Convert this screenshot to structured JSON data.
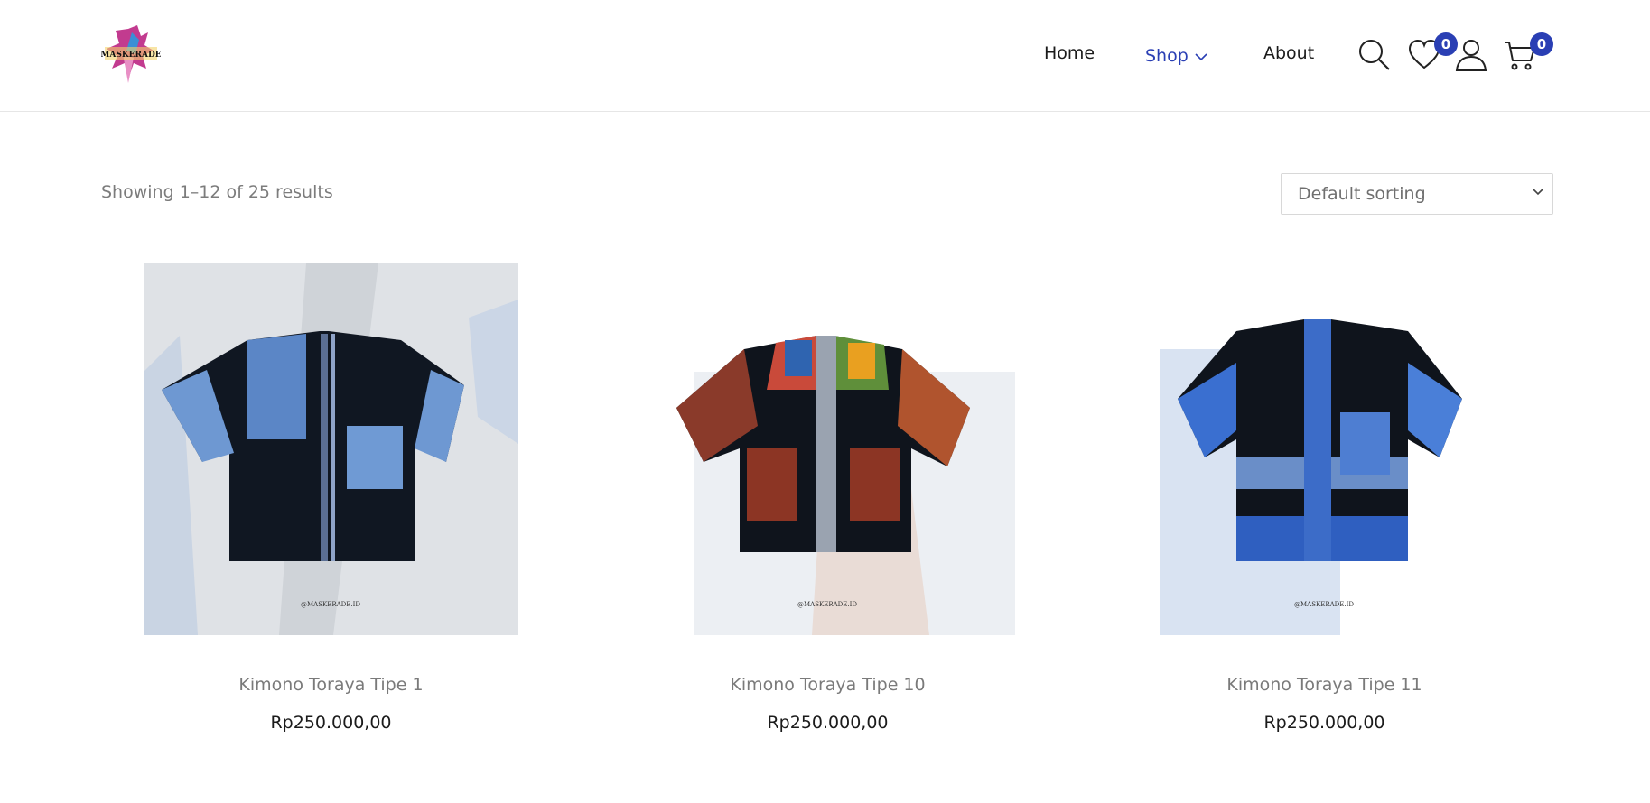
{
  "header": {
    "logo_text": "MASKERADE",
    "nav": [
      {
        "label": "Home"
      },
      {
        "label": "Shop",
        "active": true
      },
      {
        "label": "About"
      }
    ],
    "wishlist_count": "0",
    "cart_count": "0",
    "accent_color": "#2a3fb4"
  },
  "catalog": {
    "results_text": "Showing 1–12 of 25 results",
    "sorting": {
      "selected": "Default sorting"
    }
  },
  "products": [
    {
      "title": "Kimono Toraya Tipe 1",
      "price": "Rp250.000,00",
      "watermark": "@MASKERADE.ID"
    },
    {
      "title": "Kimono Toraya Tipe 10",
      "price": "Rp250.000,00",
      "watermark": "@MASKERADE.ID"
    },
    {
      "title": "Kimono Toraya Tipe 11",
      "price": "Rp250.000,00",
      "watermark": "@MASKERADE.ID"
    }
  ],
  "icons": [
    "search-icon",
    "heart-icon",
    "user-icon",
    "cart-icon",
    "chevron-down-icon"
  ]
}
